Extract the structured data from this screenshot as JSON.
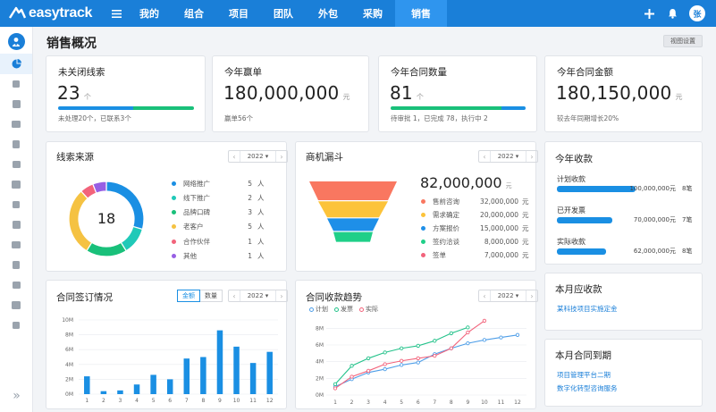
{
  "app": {
    "name": "easytrack"
  },
  "nav": {
    "items": [
      {
        "label": "我的",
        "active": false
      },
      {
        "label": "组合",
        "active": false
      },
      {
        "label": "项目",
        "active": false
      },
      {
        "label": "团队",
        "active": false
      },
      {
        "label": "外包",
        "active": false
      },
      {
        "label": "采购",
        "active": false
      },
      {
        "label": "销售",
        "active": true
      }
    ]
  },
  "header": {
    "avatar": "张",
    "icons": [
      "plus-icon",
      "bell-icon"
    ]
  },
  "colors": {
    "primary": "#1a7fd8",
    "accent": "#1a8fe3",
    "green": "#19c07a",
    "teal": "#20c9b8"
  },
  "sidebar": {
    "icons": [
      "user-icon",
      "dashboard-icon",
      "list-icon",
      "briefcase-icon",
      "archive-icon",
      "chat-icon",
      "person-icon",
      "search-icon",
      "document-icon",
      "tag-icon",
      "chart-icon",
      "report-icon",
      "stamp-icon",
      "building-icon",
      "calendar-icon"
    ],
    "expand": "»"
  },
  "page": {
    "title": "销售概况",
    "view_settings": "视图设置"
  },
  "kpis": [
    {
      "title": "未关闭线索",
      "value": "23",
      "unit": "个",
      "sub": "未处理20个，已联系3个",
      "progress": [
        0.55,
        0.45
      ]
    },
    {
      "title": "今年赢单",
      "value": "180,000,000",
      "unit": "元",
      "sub": "赢单56个"
    },
    {
      "title": "今年合同数量",
      "value": "81",
      "unit": "个",
      "sub": "待审批 1，已完成 78，执行中 2",
      "progress": [
        0.82,
        0.18
      ]
    },
    {
      "title": "今年合同金额",
      "value": "180,150,000",
      "unit": "元",
      "sub": "较去年同期增长20%"
    }
  ],
  "leads": {
    "title": "线索来源",
    "year": "2022",
    "total": "18",
    "unit": "人",
    "items": [
      {
        "label": "网络推广",
        "value": 5,
        "color": "#1a8fe3"
      },
      {
        "label": "线下推广",
        "value": 2,
        "color": "#20c9b8"
      },
      {
        "label": "品牌口碑",
        "value": 3,
        "color": "#19c07a"
      },
      {
        "label": "老客户",
        "value": 5,
        "color": "#f5c242"
      },
      {
        "label": "合作伙伴",
        "value": 1,
        "color": "#f2637b"
      },
      {
        "label": "其他",
        "value": 1,
        "color": "#975fe4"
      }
    ]
  },
  "funnel": {
    "title": "商机漏斗",
    "year": "2022",
    "total": "82,000,000",
    "unit": "元",
    "stages": [
      {
        "label": "售前咨询",
        "amount": "32,000,000",
        "color": "#f97760"
      },
      {
        "label": "需求确定",
        "amount": "20,000,000",
        "color": "#fcc33a"
      },
      {
        "label": "方案报价",
        "amount": "15,000,000",
        "color": "#1e8fe8"
      },
      {
        "label": "签约洽谈",
        "amount": "8,000,000",
        "color": "#1fcf88"
      },
      {
        "label": "签单",
        "amount": "7,000,000",
        "color": "#f2637b"
      }
    ]
  },
  "receipts": {
    "title": "今年收款",
    "items": [
      {
        "label": "计划收款",
        "amount": "100,000,000元",
        "count": "8笔",
        "fraction": 1.0
      },
      {
        "label": "已开发票",
        "amount": "70,000,000元",
        "count": "7笔",
        "fraction": 0.7
      },
      {
        "label": "实际收款",
        "amount": "62,000,000元",
        "count": "8笔",
        "fraction": 0.62
      }
    ]
  },
  "due_receipts": {
    "title": "本月应收款",
    "links": [
      "某科技项目实施定金"
    ]
  },
  "due_contracts": {
    "title": "本月合同到期",
    "links": [
      "项目管理平台二期",
      "数字化转型咨询服务"
    ]
  },
  "contract_signing": {
    "title": "合同签订情况",
    "year": "2022",
    "toggle": {
      "on": "金额",
      "off": "数量"
    }
  },
  "collection_trend": {
    "title": "合同收款趋势",
    "year": "2022",
    "legend": [
      "计划",
      "发票",
      "实际"
    ]
  },
  "chart_data": [
    {
      "type": "bar",
      "categories": [
        "1",
        "2",
        "3",
        "4",
        "5",
        "6",
        "7",
        "8",
        "9",
        "10",
        "11",
        "12"
      ],
      "values": [
        2.4,
        0.4,
        0.5,
        1.3,
        2.6,
        2.0,
        4.8,
        5.0,
        8.6,
        6.4,
        4.2,
        5.7
      ],
      "yticks": [
        "0M",
        "2M",
        "4M",
        "6M",
        "8M",
        "10M"
      ],
      "ylim": [
        0,
        10
      ],
      "color": "#1a8fe3",
      "grid": true
    },
    {
      "type": "line",
      "x": [
        1,
        2,
        3,
        4,
        5,
        6,
        7,
        8,
        9,
        10,
        11,
        12
      ],
      "yticks": [
        "0M",
        "2M",
        "4M",
        "6M",
        "8M"
      ],
      "ylim": [
        0,
        9
      ],
      "grid": true,
      "series": [
        {
          "name": "计划",
          "color": "#4e9ee8",
          "values": [
            1.0,
            1.9,
            2.7,
            3.1,
            3.6,
            3.9,
            4.9,
            5.6,
            6.2,
            6.6,
            6.9,
            7.2
          ]
        },
        {
          "name": "发票",
          "color": "#23c28a",
          "values": [
            1.3,
            3.5,
            4.4,
            5.1,
            5.6,
            5.9,
            6.5,
            7.4,
            8.1
          ]
        },
        {
          "name": "实际",
          "color": "#f2637b",
          "values": [
            0.8,
            2.2,
            2.9,
            3.7,
            4.1,
            4.4,
            4.7,
            5.6,
            7.5,
            8.9
          ]
        }
      ]
    }
  ]
}
